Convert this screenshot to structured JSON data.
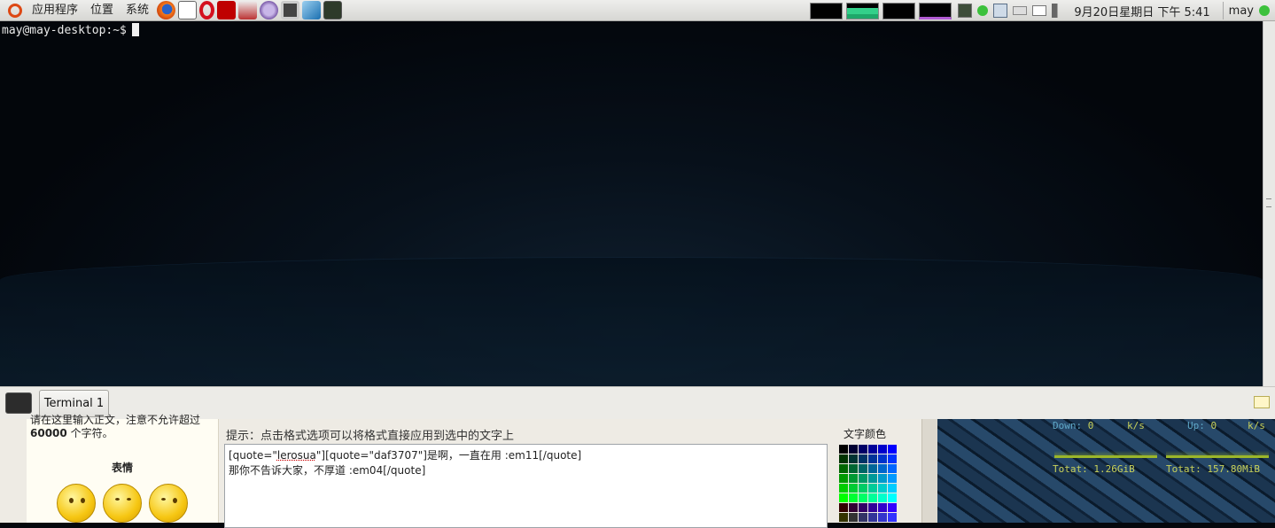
{
  "top_panel": {
    "menus": [
      "应用程序",
      "位置",
      "系统"
    ],
    "launchers": [
      "firefox-icon",
      "amsn-icon",
      "opera-icon",
      "filezilla-icon",
      "package-icon",
      "pidgin-icon",
      "camera-icon",
      "virtualbox-icon",
      "download-icon"
    ],
    "clock": "9月20日星期日 下午 5:41",
    "user": "may"
  },
  "terminal": {
    "prompt": "may@may-desktop:~$"
  },
  "tabbar": {
    "tab_label": "Terminal 1"
  },
  "web": {
    "left_text_top": "请在这里输入正文，注意不允许超过",
    "char_limit": "60000",
    "char_limit_suffix": "个字符。",
    "emoticons_title": "表情",
    "hint": "提示：点击格式选项可以将格式直接应用到选中的文字上",
    "editor_line1_a": "[quote=\"",
    "editor_line1_user": "lerosua",
    "editor_line1_b": "\"][quote=\"daf3707\"]是啊，一直在用 :em11[/quote]",
    "editor_line2": "那你不告诉大家，不厚道 :em04[/quote]",
    "color_title": "文字颜色"
  },
  "conky": {
    "down_label": "Down:",
    "down_value": "0",
    "down_unit": "k/s",
    "up_label": "Up:",
    "up_value": "0",
    "up_unit": "k/s",
    "down_total": "Totat: 1.26GiB",
    "up_total": "Totat: 157.80MiB"
  },
  "colors": {
    "terminal_bg": "#05080d",
    "panel_bg": "#e3e3df",
    "conky_text": "#c9d25a",
    "conky_label": "#5fa8c8"
  }
}
